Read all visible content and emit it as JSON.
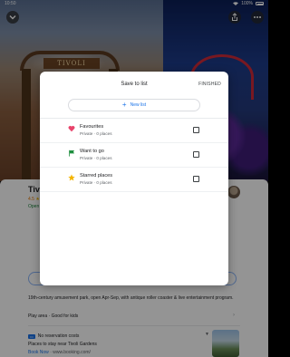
{
  "status_bar": {
    "time": "10:50",
    "battery": "100%"
  },
  "photo": {
    "gate_sign": "TIVOLI"
  },
  "place": {
    "title": "Tivol",
    "rating": "4.5",
    "open_status": "Open",
    "description": "19th-century amusement park, open Apr-Sep, with antique roller coaster & live entertainment program.",
    "tags": "Play area · Good for kids",
    "ad": {
      "headline": "No reservation costs",
      "title": "Places to stay near Tivoli Gardens",
      "cta": "Book Now",
      "domain": "· www.booking.com/"
    }
  },
  "dialog": {
    "title": "Save to list",
    "finished_label": "FINISHED",
    "new_list_label": "New list",
    "lists": [
      {
        "name": "Favourites",
        "subtitle": "Private · 0 places",
        "icon": "heart-icon",
        "color": "#e8436b"
      },
      {
        "name": "Want to go",
        "subtitle": "Private · 0 places",
        "icon": "flag-icon",
        "color": "#1e8e3e"
      },
      {
        "name": "Starred places",
        "subtitle": "Private · 0 places",
        "icon": "star-icon",
        "color": "#f4b400"
      }
    ]
  }
}
